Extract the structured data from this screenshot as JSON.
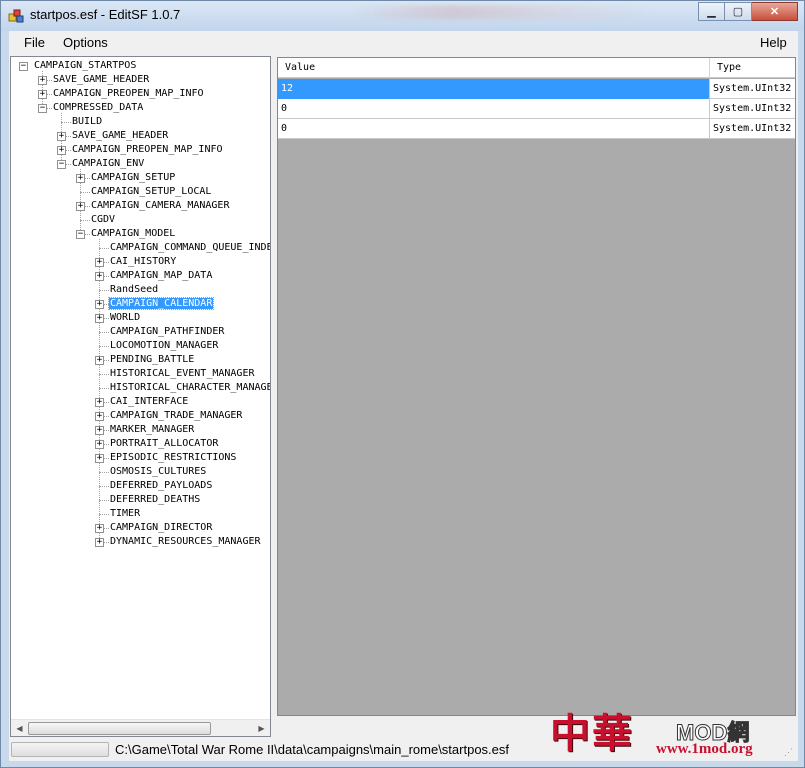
{
  "window": {
    "title": "startpos.esf - EditSF 1.0.7"
  },
  "menu": {
    "file": "File",
    "options": "Options",
    "help": "Help"
  },
  "tree": {
    "nodes": [
      {
        "label": "CAMPAIGN_STARTPOS",
        "depth": 0,
        "expander": "minus"
      },
      {
        "label": "SAVE_GAME_HEADER",
        "depth": 1,
        "expander": "plus"
      },
      {
        "label": "CAMPAIGN_PREOPEN_MAP_INFO",
        "depth": 1,
        "expander": "plus"
      },
      {
        "label": "COMPRESSED_DATA",
        "depth": 1,
        "expander": "minus"
      },
      {
        "label": "BUILD",
        "depth": 2,
        "expander": "none"
      },
      {
        "label": "SAVE_GAME_HEADER",
        "depth": 2,
        "expander": "plus"
      },
      {
        "label": "CAMPAIGN_PREOPEN_MAP_INFO",
        "depth": 2,
        "expander": "plus"
      },
      {
        "label": "CAMPAIGN_ENV",
        "depth": 2,
        "expander": "minus"
      },
      {
        "label": "CAMPAIGN_SETUP",
        "depth": 3,
        "expander": "plus"
      },
      {
        "label": "CAMPAIGN_SETUP_LOCAL",
        "depth": 3,
        "expander": "none"
      },
      {
        "label": "CAMPAIGN_CAMERA_MANAGER",
        "depth": 3,
        "expander": "plus"
      },
      {
        "label": "CGDV",
        "depth": 3,
        "expander": "none"
      },
      {
        "label": "CAMPAIGN_MODEL",
        "depth": 3,
        "expander": "minus"
      },
      {
        "label": "CAMPAIGN_COMMAND_QUEUE_INDE",
        "depth": 4,
        "expander": "none"
      },
      {
        "label": "CAI_HISTORY",
        "depth": 4,
        "expander": "plus"
      },
      {
        "label": "CAMPAIGN_MAP_DATA",
        "depth": 4,
        "expander": "plus"
      },
      {
        "label": "RandSeed",
        "depth": 4,
        "expander": "none"
      },
      {
        "label": "CAMPAIGN_CALENDAR",
        "depth": 4,
        "expander": "plus",
        "selected": true
      },
      {
        "label": "WORLD",
        "depth": 4,
        "expander": "plus"
      },
      {
        "label": "CAMPAIGN_PATHFINDER",
        "depth": 4,
        "expander": "none"
      },
      {
        "label": "LOCOMOTION_MANAGER",
        "depth": 4,
        "expander": "none"
      },
      {
        "label": "PENDING_BATTLE",
        "depth": 4,
        "expander": "plus"
      },
      {
        "label": "HISTORICAL_EVENT_MANAGER",
        "depth": 4,
        "expander": "none"
      },
      {
        "label": "HISTORICAL_CHARACTER_MANAGE",
        "depth": 4,
        "expander": "none"
      },
      {
        "label": "CAI_INTERFACE",
        "depth": 4,
        "expander": "plus"
      },
      {
        "label": "CAMPAIGN_TRADE_MANAGER",
        "depth": 4,
        "expander": "plus"
      },
      {
        "label": "MARKER_MANAGER",
        "depth": 4,
        "expander": "plus"
      },
      {
        "label": "PORTRAIT_ALLOCATOR",
        "depth": 4,
        "expander": "plus"
      },
      {
        "label": "EPISODIC_RESTRICTIONS",
        "depth": 4,
        "expander": "plus"
      },
      {
        "label": "OSMOSIS_CULTURES",
        "depth": 4,
        "expander": "none"
      },
      {
        "label": "DEFERRED_PAYLOADS",
        "depth": 4,
        "expander": "none"
      },
      {
        "label": "DEFERRED_DEATHS",
        "depth": 4,
        "expander": "none"
      },
      {
        "label": "TIMER",
        "depth": 4,
        "expander": "none"
      },
      {
        "label": "CAMPAIGN_DIRECTOR",
        "depth": 4,
        "expander": "plus"
      },
      {
        "label": "DYNAMIC_RESOURCES_MANAGER",
        "depth": 4,
        "expander": "plus"
      }
    ]
  },
  "grid": {
    "columns": [
      "Value",
      "Type"
    ],
    "rows": [
      {
        "value": "12",
        "type": "System.UInt32",
        "selected": true
      },
      {
        "value": "0",
        "type": "System.UInt32"
      },
      {
        "value": "0",
        "type": "System.UInt32"
      }
    ]
  },
  "status": {
    "path": "C:\\Game\\Total War Rome II\\data\\campaigns\\main_rome\\startpos.esf"
  },
  "watermark": {
    "cjk": "中華",
    "brand": "MOD網",
    "url": "www.1mod.org"
  },
  "colors": {
    "selection": "#3399ff",
    "grid_bg": "#ababab",
    "watermark_red": "#c8102e"
  },
  "icons": [
    "app-icon",
    "minimize-icon",
    "maximize-icon",
    "close-icon",
    "plus-box-icon",
    "minus-box-icon",
    "scroll-left-arrow-icon",
    "scroll-right-arrow-icon",
    "size-grip-icon"
  ]
}
